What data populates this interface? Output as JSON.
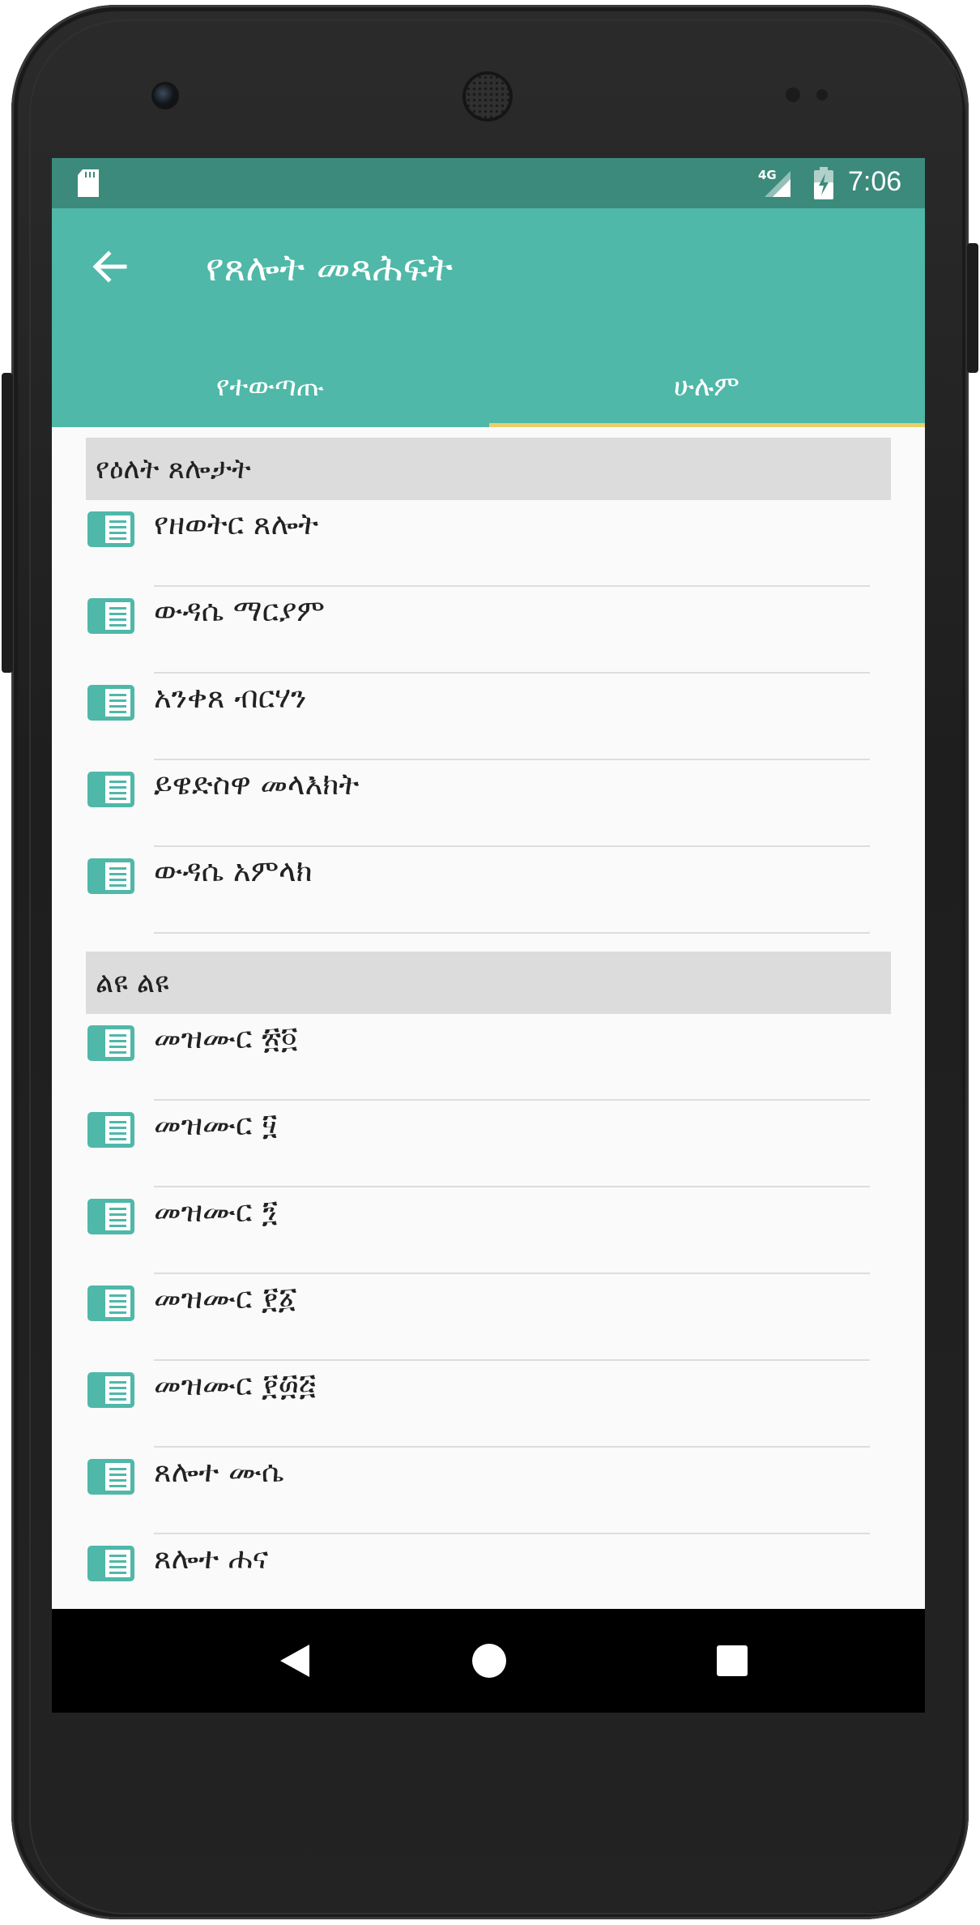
{
  "status_bar": {
    "network": "4G",
    "time": "7:06"
  },
  "app_bar": {
    "title": "የጸሎት መጻሕፍት"
  },
  "tabs": [
    {
      "label": "የተውጣጡ",
      "selected": false
    },
    {
      "label": "ሁሉም",
      "selected": true
    }
  ],
  "colors": {
    "status_bar": "#3c8a7c",
    "app_bar": "#4fb8a8",
    "tab_indicator": "#e9cf6a",
    "icon": "#4fb8a8"
  },
  "sections": [
    {
      "header": "የዕለት ጸሎታት",
      "items": [
        {
          "label": "የዘወትር ጸሎት",
          "icon": "book-icon"
        },
        {
          "label": "ውዳሴ ማርያም",
          "icon": "book-icon"
        },
        {
          "label": "አንቀጸ ብርሃን",
          "icon": "book-icon"
        },
        {
          "label": "ይዌድስዋ መላእክት",
          "icon": "book-icon"
        },
        {
          "label": "ውዳሴ አምላክ",
          "icon": "book-icon"
        }
      ]
    },
    {
      "header": "ልዩ ልዩ",
      "items": [
        {
          "label": "መዝሙር ፳፬",
          "icon": "book-icon"
        },
        {
          "label": "መዝሙር ፶",
          "icon": "book-icon"
        },
        {
          "label": "መዝሙር ፺",
          "icon": "book-icon"
        },
        {
          "label": "መዝሙር ፻፩",
          "icon": "book-icon"
        },
        {
          "label": "መዝሙር ፻፴፭",
          "icon": "book-icon"
        },
        {
          "label": "ጸሎተ ሙሴ",
          "icon": "book-icon"
        },
        {
          "label": "ጸሎተ ሐና",
          "icon": "book-icon"
        }
      ]
    }
  ]
}
